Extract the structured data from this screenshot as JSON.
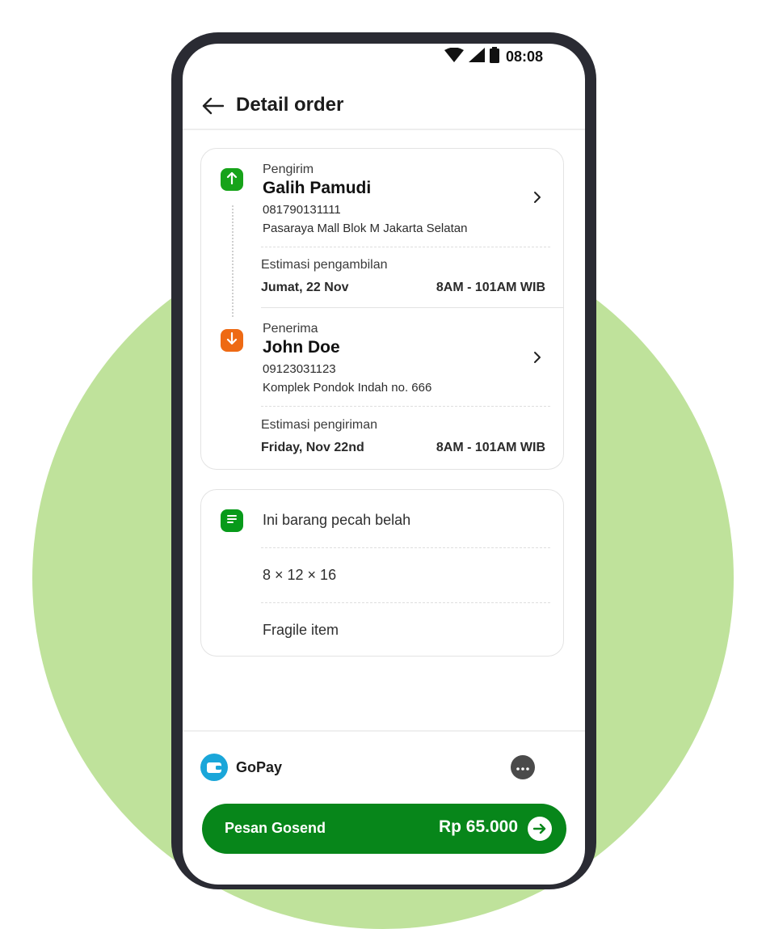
{
  "status_bar": {
    "time": "08:08"
  },
  "header": {
    "title": "Detail order"
  },
  "sender": {
    "label": "Pengirim",
    "name": "Galih Pamudi",
    "phone": "081790131111",
    "address": "Pasaraya Mall Blok M Jakarta Selatan",
    "estimate_label": "Estimasi pengambilan",
    "estimate_date": "Jumat, 22 Nov",
    "estimate_time": "8AM - 101AM WIB"
  },
  "recipient": {
    "label": "Penerima",
    "name": "John Doe",
    "phone": "09123031123",
    "address": "Komplek Pondok Indah no. 666",
    "estimate_label": "Estimasi pengiriman",
    "estimate_date": "Friday, Nov 22nd",
    "estimate_time": "8AM - 101AM WIB"
  },
  "notes": {
    "description": "Ini barang pecah belah",
    "dimensions": "8 × 12 × 16",
    "category": "Fragile item"
  },
  "payment": {
    "method": "GoPay"
  },
  "order_button": {
    "label": "Pesan Gosend",
    "price": "Rp 65.000"
  },
  "colors": {
    "brand_green": "#07861a",
    "pickup_pin": "#17a31a",
    "dropoff_pin": "#ee6a14",
    "gopay_blue": "#1aa6d9",
    "background_circle": "#bfe29b"
  },
  "icons": [
    "wifi-icon",
    "signal-icon",
    "battery-icon",
    "back-arrow-icon",
    "pickup-arrow-up-icon",
    "dropoff-arrow-down-icon",
    "chevron-right-icon",
    "notes-icon",
    "gopay-wallet-icon",
    "more-dots-icon",
    "arrow-right-icon"
  ]
}
